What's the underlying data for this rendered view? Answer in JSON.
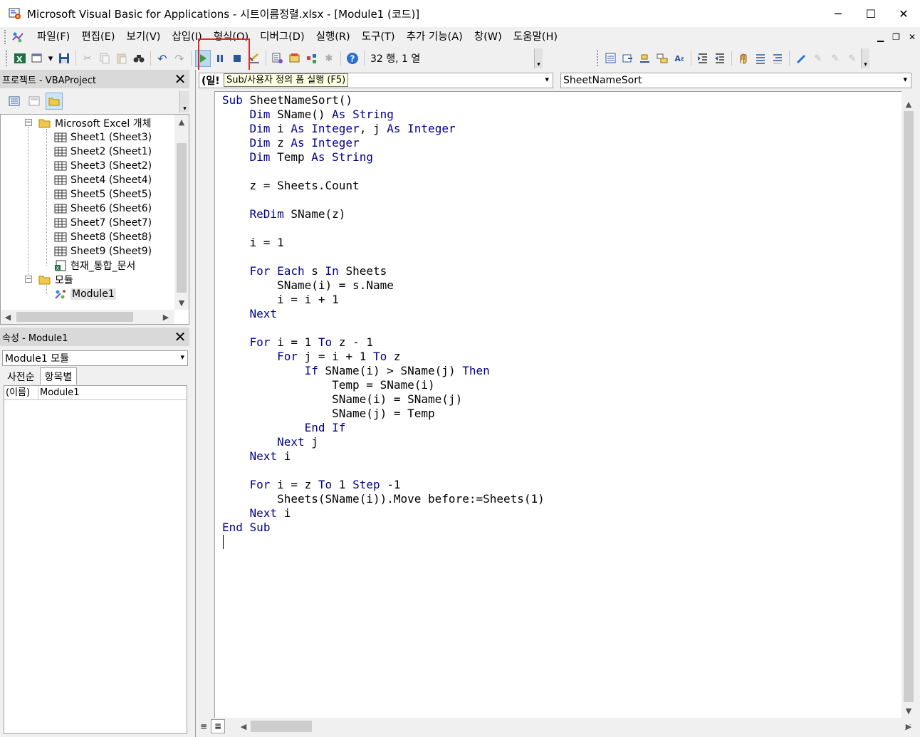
{
  "window": {
    "title": "Microsoft Visual Basic for Applications - 시트이름정렬.xlsx - [Module1 (코드)]",
    "controls": [
      "─",
      "☐",
      "✕"
    ]
  },
  "menu": {
    "items": [
      "파일(F)",
      "편집(E)",
      "보기(V)",
      "삽입(I)",
      "형식(O)",
      "디버그(D)",
      "실행(R)",
      "도구(T)",
      "추가 기능(A)",
      "창(W)",
      "도움말(H)"
    ]
  },
  "toolbar": {
    "position": "32 행, 1 열",
    "run_tooltip": "Sub/사용자 정의 폼 실행 (F5)"
  },
  "project": {
    "title": "프로젝트 - VBAProject",
    "tree": {
      "excel_objects": "Microsoft Excel 개체",
      "sheets": [
        "Sheet1 (Sheet3)",
        "Sheet2 (Sheet1)",
        "Sheet3 (Sheet2)",
        "Sheet4 (Sheet4)",
        "Sheet5 (Sheet5)",
        "Sheet6 (Sheet6)",
        "Sheet7 (Sheet7)",
        "Sheet8 (Sheet8)",
        "Sheet9 (Sheet9)",
        "현재_통합_문서"
      ],
      "modules_folder": "모듈",
      "module": "Module1"
    }
  },
  "properties": {
    "title": "속성 - Module1",
    "object_combo": "Module1 모듈",
    "tabs": [
      "사전순",
      "항목별"
    ],
    "rows": [
      {
        "key": "(이름)",
        "value": "Module1"
      }
    ]
  },
  "code": {
    "object_combo": "(일반)",
    "object_combo_visible": "(일!",
    "proc_combo": "SheetNameSort",
    "lines": [
      "Sub SheetNameSort()",
      "    Dim SName() As String",
      "    Dim i As Integer, j As Integer",
      "    Dim z As Integer",
      "    Dim Temp As String",
      "",
      "    z = Sheets.Count",
      "",
      "    ReDim SName(z)",
      "",
      "    i = 1",
      "",
      "    For Each s In Sheets",
      "        SName(i) = s.Name",
      "        i = i + 1",
      "    Next",
      "",
      "    For i = 1 To z - 1",
      "        For j = i + 1 To z",
      "            If SName(i) > SName(j) Then",
      "                Temp = SName(i)",
      "                SName(i) = SName(j)",
      "                SName(j) = Temp",
      "            End If",
      "        Next j",
      "    Next i",
      "",
      "    For i = z To 1 Step -1",
      "        Sheets(SName(i)).Move before:=Sheets(1)",
      "    Next i",
      "End Sub"
    ],
    "keywords": [
      "Sub",
      "Dim",
      "As",
      "String",
      "Integer",
      "ReDim",
      "For",
      "Each",
      "In",
      "Next",
      "To",
      "If",
      "Then",
      "End",
      "Step"
    ]
  },
  "colors": {
    "keyword": "#00008b",
    "highlight_box": "#e8242b",
    "tooltip_bg": "#ffffe1"
  }
}
